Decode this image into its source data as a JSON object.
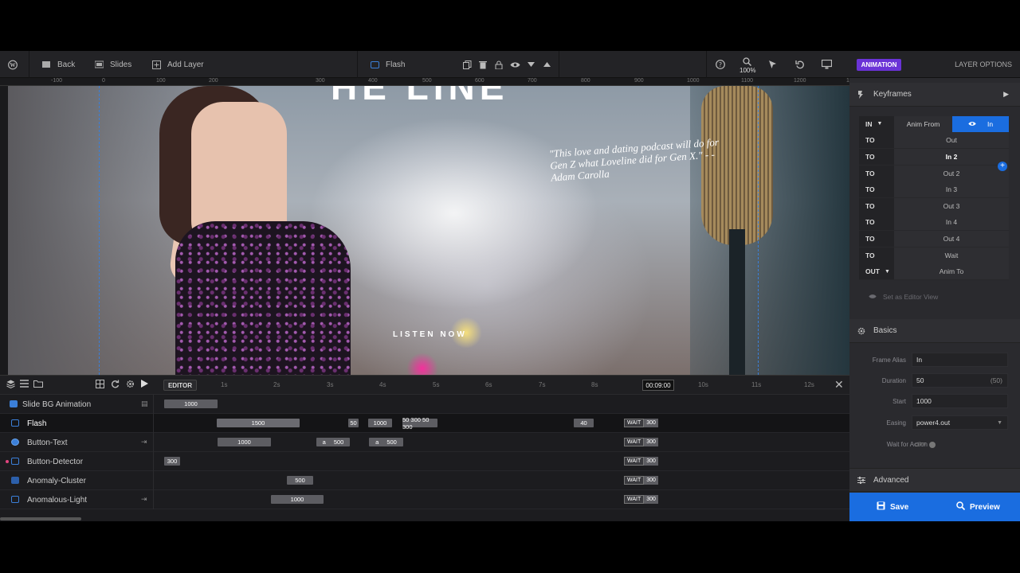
{
  "toolbar": {
    "back_label": "Back",
    "slides_label": "Slides",
    "add_layer_label": "Add Layer",
    "layer_name": "Flash",
    "zoom": "100%"
  },
  "ruler": {
    "marks": [
      "-100",
      "0",
      "100",
      "200",
      "300",
      "400",
      "500",
      "600",
      "700",
      "800",
      "900",
      "1000",
      "1100",
      "1200",
      "1300"
    ]
  },
  "canvas": {
    "headline": "HE LINE",
    "quote": "\"This love and dating podcast will do for Gen Z what Loveline did for Gen X.\" - - Adam Carolla",
    "cta": "LISTEN NOW"
  },
  "timeline": {
    "editor_label": "EDITOR",
    "ticks": [
      "1s",
      "2s",
      "3s",
      "4s",
      "5s",
      "6s",
      "7s",
      "8s",
      "10s",
      "11s",
      "12s"
    ],
    "current_time": "00:09:00",
    "slide_bg_label": "Slide BG Animation",
    "slide_bg_bar": "1000",
    "rows": [
      {
        "name": "Flash",
        "bars": [
          "1500",
          "50",
          "1000",
          "50 300 50 300",
          "40"
        ],
        "wait": "WAIT",
        "wait_value": "300"
      },
      {
        "name": "Button-Text",
        "bars": [
          "1000",
          "500",
          "500"
        ],
        "prefix": "a",
        "wait": "WAIT",
        "wait_value": "300"
      },
      {
        "name": "Button-Detector",
        "bars": [
          "300"
        ],
        "wait": "WAIT",
        "wait_value": "300"
      },
      {
        "name": "Anomaly-Cluster",
        "bars": [
          "500"
        ],
        "wait": "WAIT",
        "wait_value": "300"
      },
      {
        "name": "Anomalous-Light",
        "bars": [
          "1000"
        ],
        "wait": "WAIT",
        "wait_value": "300"
      }
    ]
  },
  "panel": {
    "animation_tab": "ANIMATION",
    "layer_options_tab": "LAYER OPTIONS",
    "keyframes_title": "Keyframes",
    "keyframes": [
      {
        "type": "IN",
        "name": "Anim From",
        "active_name": "In"
      },
      {
        "type": "TO",
        "name": "Out"
      },
      {
        "type": "TO",
        "name": "In 2"
      },
      {
        "type": "TO",
        "name": "Out 2"
      },
      {
        "type": "TO",
        "name": "In 3"
      },
      {
        "type": "TO",
        "name": "Out 3"
      },
      {
        "type": "TO",
        "name": "In 4"
      },
      {
        "type": "TO",
        "name": "Out 4"
      },
      {
        "type": "TO",
        "name": "Wait"
      },
      {
        "type": "OUT",
        "name": "Anim To"
      }
    ],
    "set_editor_view": "Set as Editor View",
    "basics_title": "Basics",
    "frame_alias_label": "Frame Alias",
    "frame_alias_value": "In",
    "duration_label": "Duration",
    "duration_value": "50",
    "duration_hint": "(50)",
    "start_label": "Start",
    "start_value": "1000",
    "easing_label": "Easing",
    "easing_value": "power4.out",
    "wait_action_label": "Wait for Action",
    "wait_action_value": "OFF",
    "advanced_title": "Advanced",
    "save_label": "Save",
    "preview_label": "Preview"
  },
  "colors": {
    "accent_blue": "#1a6de0",
    "animation_tab": "#6a33d6",
    "marker_pink": "#e3447f"
  }
}
